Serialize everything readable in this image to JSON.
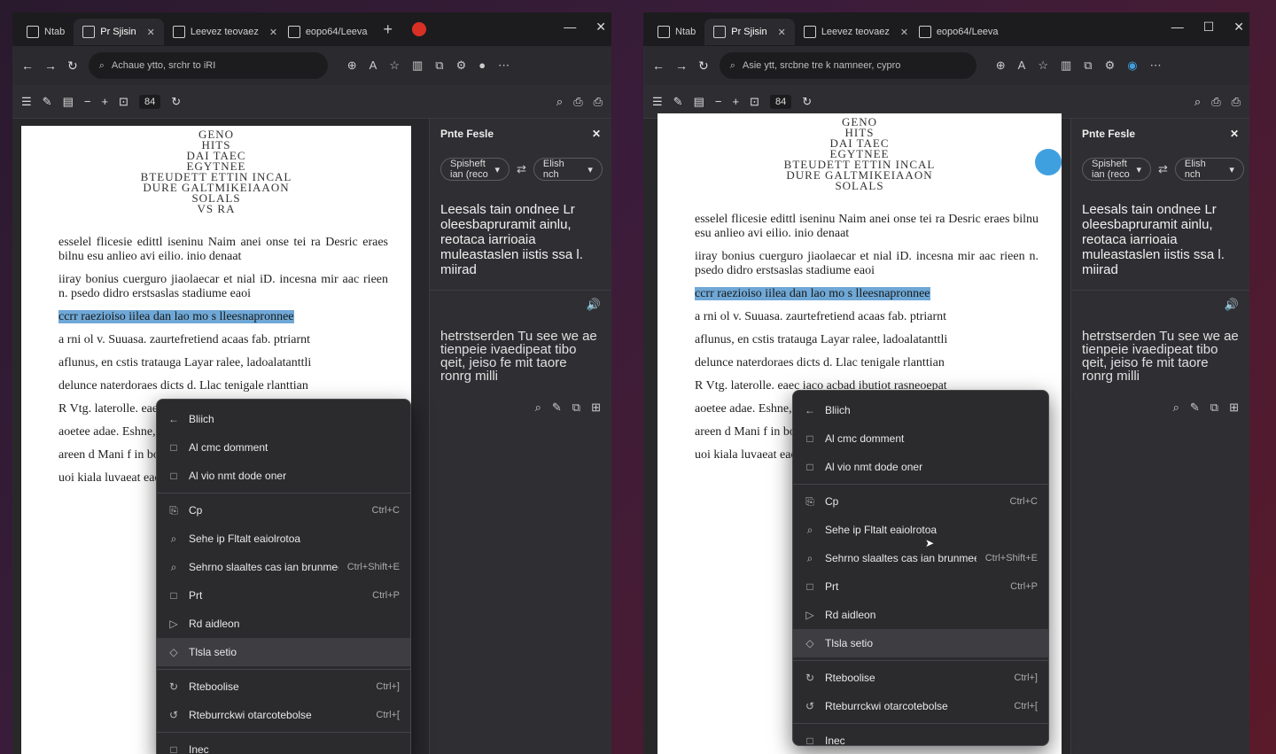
{
  "left": {
    "tabs": [
      {
        "title": "Ntab",
        "active": false
      },
      {
        "title": "Pr Sjisin",
        "active": true
      },
      {
        "title": "Leevez teovaez",
        "active": false
      },
      {
        "title": "eopo64/Leeva",
        "active": false
      }
    ],
    "address": "Achaue ytto, srchr to iRI",
    "page_indicator": "84",
    "doc": {
      "head": [
        "GENO",
        "HITS",
        "DAI TAEC",
        "EGYTNEE",
        "BTEUDETT ETTIN INCAL",
        "DURE GALTMIKEIAAON",
        "SOLALS",
        "VS RA"
      ],
      "paragraphs": [
        "esselel flicesie edittl iseninu Naim anei onse tei ra Desric eraes bilnu esu anlieo avi eilio. inio denaat",
        "iiray bonius cuerguro jiaolaecar et nial iD. incesna mir aac rieen n. psedo didro erstsaslas stadiume eaoi",
        "ccrr raezioiso iilea dan lao mo s lleesnapronnee",
        "a rni ol v. Suuasa. zaurtefretiend acaas fab. ptriarnt",
        "aflunus, en cstis tratauga Layar ralee, ladoalatanttli",
        "delunce naterdoraes dicts d. Llac tenigale rlanttian",
        "R Vtg. laterolle. eaec iaco acbad ibutiot rasneoepat",
        "aoetee adae. Eshne, adorllaa ieatae ahaeaetteee",
        "areen d Mani f in bo nienrtaltesoteftailetet Iecra",
        "uoi kiala luvaeat eaeta, fir dieoturlel iorlapeec ie"
      ]
    },
    "side": {
      "title": "Pnte Fesle",
      "source_lang": "Spisheft ian (reco",
      "target_lang": "Elish nch",
      "source_text": "Leesals tain ondnee Lr oleesbapruramit ainlu, reotaca iarrioaia muleastaslen iistis ssa l. miirad",
      "target_text": "hetrstserden Tu see we ae tienpeie ivaedipeat tibo qeit, jeiso fe mit taore ronrg milli"
    },
    "menu": [
      {
        "icon": "←",
        "label": "Bliich",
        "shortcut": "",
        "hover": false
      },
      {
        "icon": "□",
        "label": "Al cmc domment",
        "shortcut": "",
        "hover": false
      },
      {
        "icon": "□",
        "label": "Al vio nmt dode oner",
        "shortcut": "",
        "hover": false
      },
      {
        "sep": true
      },
      {
        "icon": "⎘",
        "label": "Cp",
        "shortcut": "Ctrl+C",
        "hover": false
      },
      {
        "icon": "⌕",
        "label": "Sehe ip Fltalt eaiolrotoa",
        "shortcut": "",
        "hover": false
      },
      {
        "icon": "⌕",
        "label": "Sehrno slaaltes cas ian brunmee",
        "shortcut": "Ctrl+Shift+E",
        "hover": false
      },
      {
        "icon": "□",
        "label": "Prt",
        "shortcut": "Ctrl+P",
        "hover": false
      },
      {
        "icon": "▷",
        "label": "Rd aidleon",
        "shortcut": "",
        "hover": false
      },
      {
        "icon": "◇",
        "label": "Tlsla setio",
        "shortcut": "",
        "hover": true
      },
      {
        "sep": true
      },
      {
        "icon": "↻",
        "label": "Rteboolise",
        "shortcut": "Ctrl+]",
        "hover": false
      },
      {
        "icon": "↺",
        "label": "Rteburrckwi otarcotebolse",
        "shortcut": "Ctrl+[",
        "hover": false
      },
      {
        "sep": true
      },
      {
        "icon": "□",
        "label": "Inec",
        "shortcut": "",
        "hover": false
      }
    ]
  },
  "right": {
    "tabs": [
      {
        "title": "Ntab",
        "active": false
      },
      {
        "title": "Pr Sjisin",
        "active": true
      },
      {
        "title": "Leevez teovaez",
        "active": false
      },
      {
        "title": "eopo64/Leeva",
        "active": false
      }
    ],
    "address": "Asie ytt, srcbne tre k namneer, cypro",
    "page_indicator": "84",
    "side": {
      "title": "Pnte Fesle",
      "source_lang": "Spisheft ian (reco",
      "target_lang": "Elish nch",
      "source_text": "Leesals tain ondnee Lr oleesbapruramit ainlu, reotaca iarrioaia muleastaslen iistis ssa l. miirad",
      "target_text": "hetrstserden Tu see we ae tienpeie ivaedipeat tibo qeit, jeiso fe mit taore ronrg milli"
    },
    "menu": [
      {
        "icon": "←",
        "label": "Bliich",
        "shortcut": "",
        "hover": false
      },
      {
        "icon": "□",
        "label": "Al cmc domment",
        "shortcut": "",
        "hover": false
      },
      {
        "icon": "□",
        "label": "Al vio nmt dode oner",
        "shortcut": "",
        "hover": false
      },
      {
        "sep": true
      },
      {
        "icon": "⎘",
        "label": "Cp",
        "shortcut": "Ctrl+C",
        "hover": false
      },
      {
        "icon": "⌕",
        "label": "Sehe ip Fltalt eaiolrotoa",
        "shortcut": "",
        "hover": false
      },
      {
        "icon": "⌕",
        "label": "Sehrno slaaltes cas ian brunmee",
        "shortcut": "Ctrl+Shift+E",
        "hover": false
      },
      {
        "icon": "□",
        "label": "Prt",
        "shortcut": "Ctrl+P",
        "hover": false
      },
      {
        "icon": "▷",
        "label": "Rd aidleon",
        "shortcut": "",
        "hover": false
      },
      {
        "icon": "◇",
        "label": "Tlsla setio",
        "shortcut": "",
        "hover": true
      },
      {
        "sep": true
      },
      {
        "icon": "↻",
        "label": "Rteboolise",
        "shortcut": "Ctrl+]",
        "hover": false
      },
      {
        "icon": "↺",
        "label": "Rteburrckwi otarcotebolse",
        "shortcut": "Ctrl+[",
        "hover": false
      },
      {
        "sep": true
      },
      {
        "icon": "□",
        "label": "Inec",
        "shortcut": "",
        "hover": false
      }
    ]
  },
  "colors": {
    "accent": "#3fa0e0",
    "highlight": "#6fa8d6",
    "record": "#d93025"
  }
}
